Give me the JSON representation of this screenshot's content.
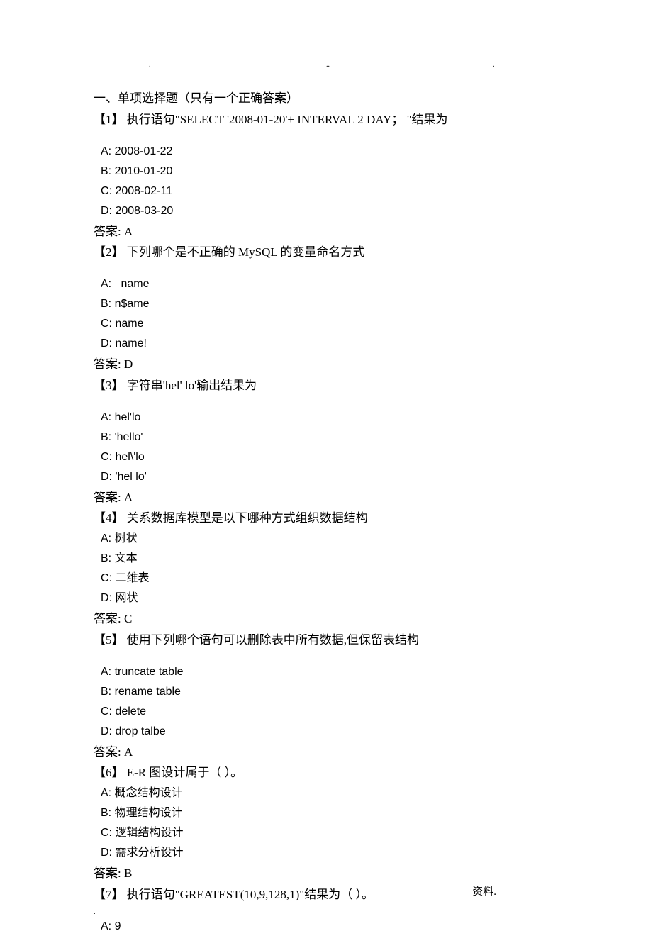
{
  "header_dot1": ".",
  "header_dot2": "..",
  "header_dot3": ".",
  "section_title": "一、单项选择题（只有一个正确答案）",
  "questions": [
    {
      "num": "【1】",
      "text": "执行语句\"SELECT '2008-01-20'+ INTERVAL 2 DAY；  \"结果为",
      "spacer_before_options": true,
      "options": [
        "A:  2008-01-22",
        "B:  2010-01-20",
        "C:  2008-02-11",
        "D:  2008-03-20"
      ],
      "answer": "答案: A"
    },
    {
      "num": "【2】",
      "text": "下列哪个是不正确的 MySQL 的变量命名方式",
      "spacer_before_options": true,
      "options": [
        "A:  _name",
        "B:  n$ame",
        "C:  name",
        "D:  name!"
      ],
      "answer": "答案: D"
    },
    {
      "num": "【3】",
      "text": "字符串'hel' lo'输出结果为",
      "spacer_before_options": true,
      "options": [
        "A:  hel'lo",
        "B:  'hello'",
        "C:  hel\\'lo",
        "D:  'hel lo'"
      ],
      "answer": "答案: A"
    },
    {
      "num": "【4】",
      "text": "关系数据库模型是以下哪种方式组织数据结构",
      "spacer_before_options": false,
      "options": [
        "A:  树状",
        "B:  文本",
        "C:  二维表",
        "D:  网状"
      ],
      "answer": "答案: C"
    },
    {
      "num": "【5】",
      "text": "使用下列哪个语句可以删除表中所有数据,但保留表结构",
      "spacer_before_options": true,
      "options": [
        "A:  truncate table",
        "B:  rename table",
        "C:  delete",
        "D:  drop talbe"
      ],
      "answer": "答案: A"
    },
    {
      "num": "【6】",
      "text": "E-R 图设计属于（  ）。",
      "spacer_before_options": false,
      "options": [
        "A:  概念结构设计",
        "B:  物理结构设计",
        "C:  逻辑结构设计",
        "D:  需求分析设计"
      ],
      "answer": "答案: B"
    },
    {
      "num": "【7】",
      "text": "执行语句\"GREATEST(10,9,128,1)\"结果为（  ）。",
      "spacer_before_options": true,
      "options": [
        "A:  9"
      ],
      "answer": ""
    }
  ],
  "footer": "资料.",
  "footer_dot": "."
}
